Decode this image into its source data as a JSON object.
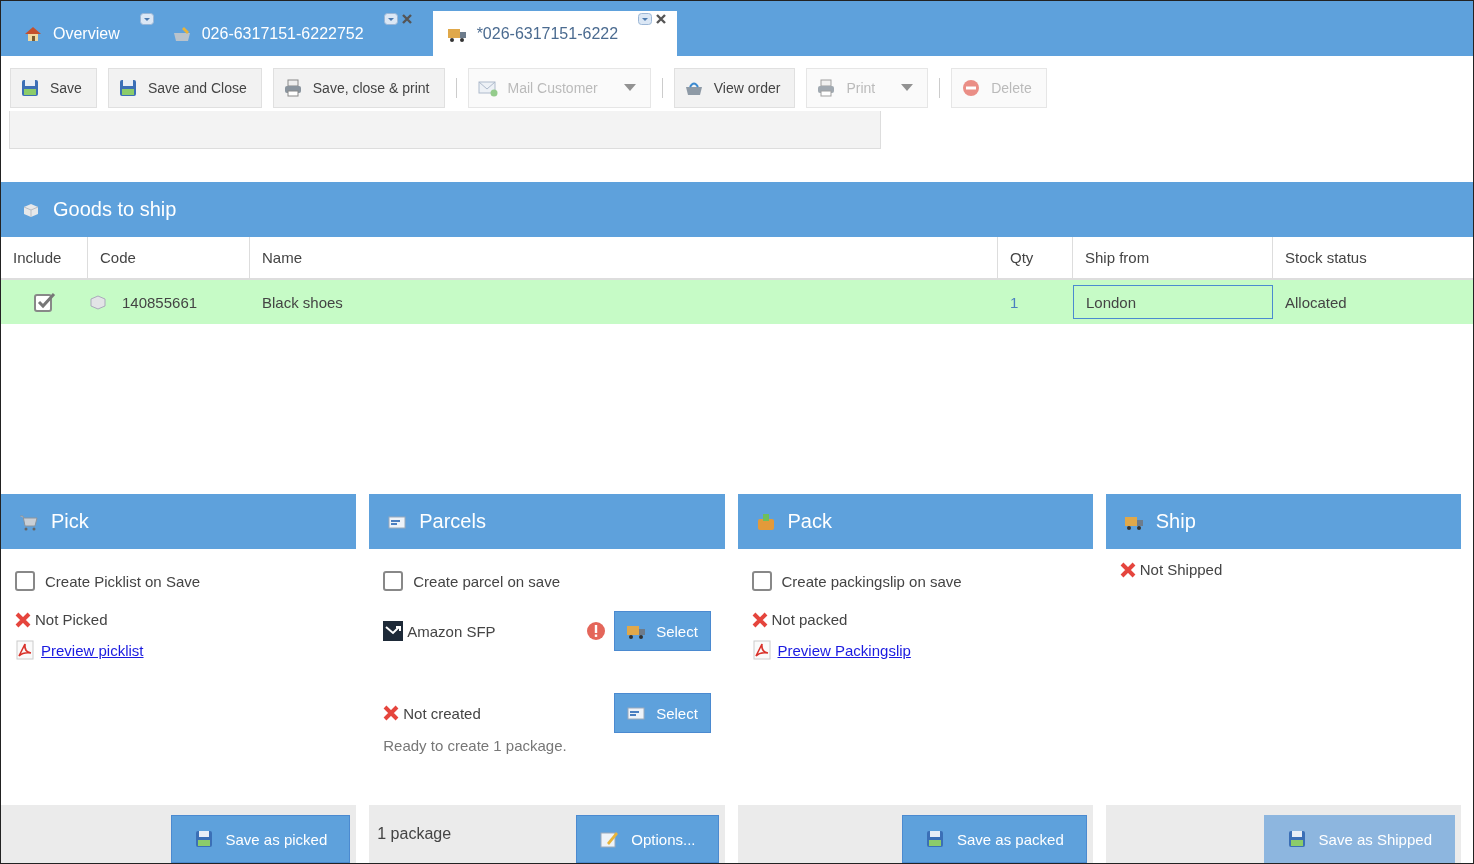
{
  "tabs": [
    {
      "label": "Overview",
      "selected": false,
      "closable": false
    },
    {
      "label": "026-6317151-6222752",
      "selected": false,
      "closable": true
    },
    {
      "label": "*026-6317151-6222",
      "selected": true,
      "closable": true
    }
  ],
  "toolbar": [
    {
      "kind": "button",
      "label": "Save",
      "disabled": false,
      "dropdown": false
    },
    {
      "kind": "button",
      "label": "Save and Close",
      "disabled": false,
      "dropdown": false
    },
    {
      "kind": "button",
      "label": "Save, close & print",
      "disabled": false,
      "dropdown": false
    },
    {
      "kind": "separator"
    },
    {
      "kind": "button",
      "label": "Mail Customer",
      "disabled": true,
      "dropdown": true
    },
    {
      "kind": "separator"
    },
    {
      "kind": "button",
      "label": "View order",
      "disabled": false,
      "dropdown": false
    },
    {
      "kind": "button",
      "label": "Print",
      "disabled": true,
      "dropdown": true
    },
    {
      "kind": "separator"
    },
    {
      "kind": "button",
      "label": "Delete",
      "disabled": true,
      "dropdown": false
    }
  ],
  "goods": {
    "title": "Goods to ship",
    "columns": [
      "Include",
      "Code",
      "Name",
      "Qty",
      "Ship from",
      "Stock status"
    ],
    "rows": [
      {
        "selected": true,
        "include": true,
        "code": "140855661",
        "name": "Black shoes",
        "qty": "1",
        "ship_from": "London",
        "stock_status": "Allocated"
      }
    ]
  },
  "panels": [
    {
      "title": "Pick",
      "checkbox": {
        "label": "Create Picklist on Save",
        "checked": false
      },
      "status": {
        "text": "Not Picked"
      },
      "link": "Preview picklist",
      "footer": {
        "button": {
          "label": "Save as picked",
          "disabled": false
        }
      }
    },
    {
      "title": "Parcels",
      "checkbox": {
        "label": "Create parcel on save",
        "checked": false
      },
      "carrier": {
        "name": "Amazon SFP",
        "warning": true,
        "button": "Select"
      },
      "status": {
        "text": "Not created",
        "button": "Select"
      },
      "note": "Ready to create 1 package.",
      "footer": {
        "text": "1 package",
        "button": {
          "label": "Options...",
          "disabled": false
        }
      }
    },
    {
      "title": "Pack",
      "checkbox": {
        "label": "Create packingslip on save",
        "checked": false
      },
      "status": {
        "text": "Not packed"
      },
      "link": "Preview Packingslip",
      "footer": {
        "button": {
          "label": "Save as packed",
          "disabled": false
        }
      }
    },
    {
      "title": "Ship",
      "status": {
        "text": "Not Shipped"
      },
      "footer": {
        "button": {
          "label": "Save as Shipped",
          "disabled": true
        }
      }
    }
  ]
}
